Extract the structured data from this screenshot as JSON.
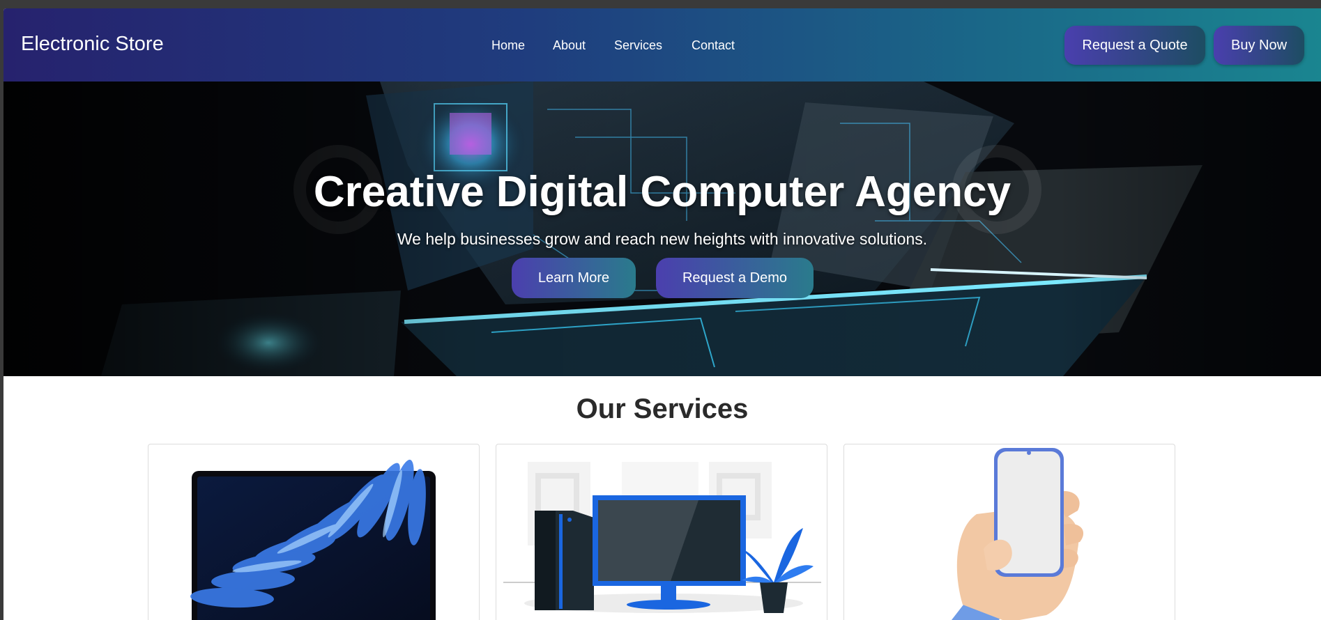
{
  "brand": "Electronic Store",
  "nav": {
    "links": [
      "Home",
      "About",
      "Services",
      "Contact"
    ],
    "request_quote": "Request a Quote",
    "buy_now": "Buy Now"
  },
  "hero": {
    "title": "Creative Digital Computer Agency",
    "subtitle": "We help businesses grow and reach new heights with innovative solutions.",
    "learn_more": "Learn More",
    "request_demo": "Request a Demo"
  },
  "services": {
    "title": "Our Services",
    "cards": [
      {
        "image": "laptop-image"
      },
      {
        "image": "desktop-computer-illustration"
      },
      {
        "image": "hand-holding-phone-image"
      }
    ]
  },
  "colors": {
    "nav_gradient_start": "#26226e",
    "nav_gradient_end": "#1a8590",
    "button_gradient_start": "#4a3fae",
    "button_gradient_end": "#1d4d62",
    "accent_blue": "#1a66e0"
  }
}
